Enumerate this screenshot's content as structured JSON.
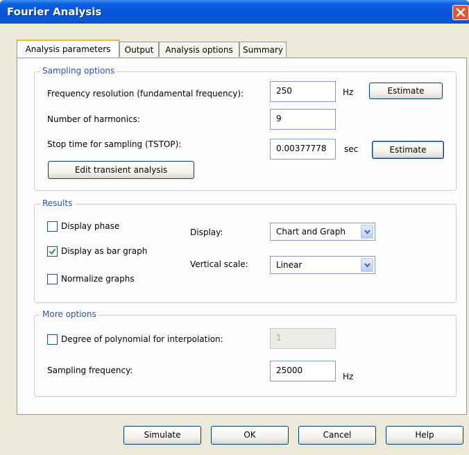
{
  "window": {
    "title": "Fourier Analysis"
  },
  "tabs": [
    {
      "label": "Analysis parameters",
      "active": true
    },
    {
      "label": "Output",
      "active": false
    },
    {
      "label": "Analysis options",
      "active": false
    },
    {
      "label": "Summary",
      "active": false
    }
  ],
  "sampling": {
    "group_title": "Sampling options",
    "freq_label": "Frequency resolution (fundamental frequency):",
    "freq_value": "250",
    "freq_unit": "Hz",
    "estimate1_label": "Estimate",
    "harmonics_label": "Number of harmonics:",
    "harmonics_value": "9",
    "stop_label": "Stop time for sampling (TSTOP):",
    "stop_value": "0.00377778",
    "stop_unit": "sec",
    "estimate2_label": "Estimate",
    "edit_label": "Edit transient analysis"
  },
  "results": {
    "group_title": "Results",
    "display_phase_label": "Display phase",
    "display_phase_checked": false,
    "bar_graph_label": "Display as bar graph",
    "bar_graph_checked": true,
    "normalize_label": "Normalize graphs",
    "normalize_checked": false,
    "display_label": "Display:",
    "display_value": "Chart and Graph",
    "vscale_label": "Vertical scale:",
    "vscale_value": "Linear"
  },
  "more": {
    "group_title": "More options",
    "poly_label": "Degree of polynomial for interpolation:",
    "poly_checked": false,
    "poly_value": "1",
    "sampfreq_label": "Sampling frequency:",
    "sampfreq_value": "25000",
    "sampfreq_unit": "Hz"
  },
  "buttons": {
    "simulate": "Simulate",
    "ok": "OK",
    "cancel": "Cancel",
    "help": "Help"
  },
  "colors": {
    "titlebar": "#0554d8",
    "group_title": "#2e54a0",
    "checkmark": "#21a121",
    "close": "#e1563a"
  }
}
